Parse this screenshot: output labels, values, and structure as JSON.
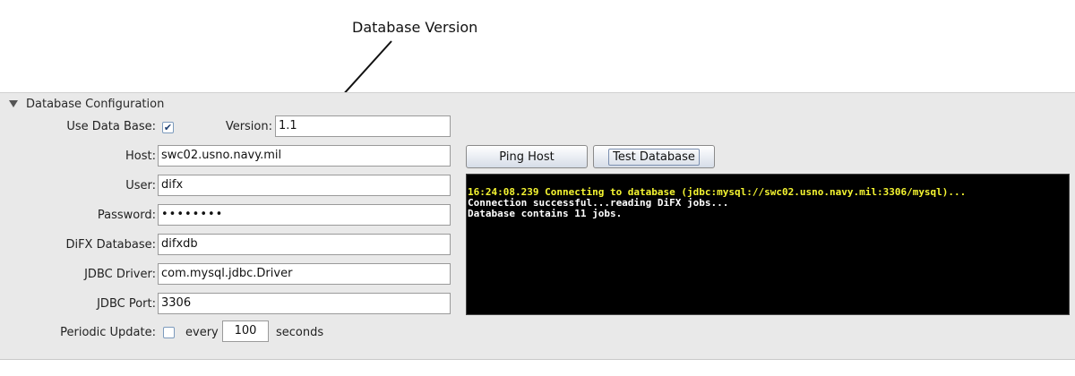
{
  "annotation": {
    "text": "Database Version"
  },
  "panel": {
    "title": "Database Configuration"
  },
  "form": {
    "use_database_label": "Use Data Base:",
    "use_database_checked": true,
    "version_label": "Version:",
    "version_value": "1.1",
    "host_label": "Host:",
    "host_value": "swc02.usno.navy.mil",
    "user_label": "User:",
    "user_value": "difx",
    "password_label": "Password:",
    "password_value": "••••••••",
    "difx_database_label": "DiFX Database:",
    "difx_database_value": "difxdb",
    "jdbc_driver_label": "JDBC Driver:",
    "jdbc_driver_value": "com.mysql.jdbc.Driver",
    "jdbc_port_label": "JDBC Port:",
    "jdbc_port_value": "3306",
    "periodic_update_label": "Periodic Update:",
    "periodic_update_checked": false,
    "every_label": "every",
    "every_value": "100",
    "seconds_label": "seconds"
  },
  "buttons": {
    "ping_host": "Ping Host",
    "test_database": "Test Database"
  },
  "console": {
    "lines": [
      {
        "text": "16:24:08.239 Connecting to database (jdbc:mysql://swc02.usno.navy.mil:3306/mysql)...",
        "color": "#f5f531"
      },
      {
        "text": "Connection successful...reading DiFX jobs...",
        "color": "#ffffff"
      },
      {
        "text": "Database contains 11 jobs.",
        "color": "#ffffff"
      }
    ]
  },
  "colors": {
    "panel_bg": "#e9e9e9",
    "console_bg": "#000000",
    "console_highlight": "#f5f531"
  }
}
